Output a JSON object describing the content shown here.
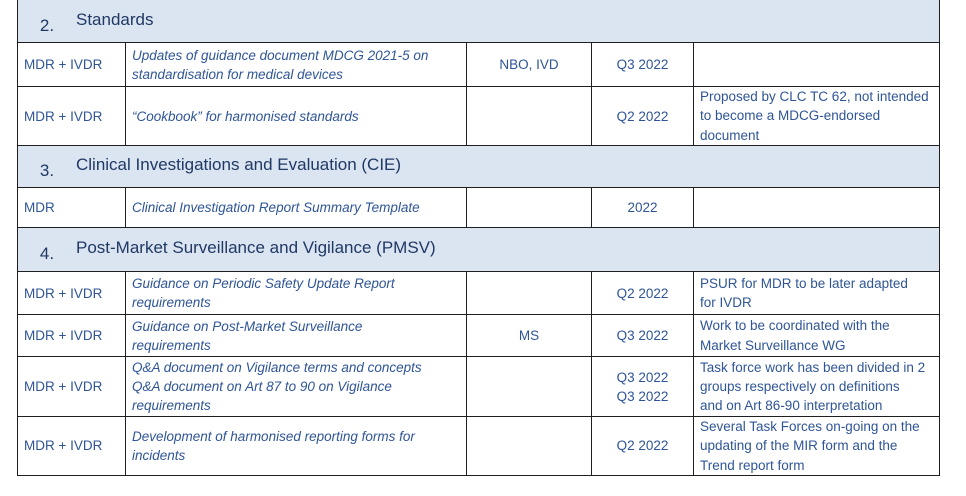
{
  "sections": [
    {
      "number": "2.",
      "title": "Standards"
    },
    {
      "number": "3.",
      "title": "Clinical Investigations and Evaluation (CIE)"
    },
    {
      "number": "4.",
      "title": "Post-Market Surveillance and Vigilance (PMSV)"
    }
  ],
  "rows": [
    {
      "scope": "MDR + IVDR",
      "document": [
        "Updates of guidance document MDCG 2021-5 on",
        "standardisation for medical devices"
      ],
      "stakeholders": "NBO, IVD",
      "timeline": [
        "Q3 2022"
      ],
      "comments": []
    },
    {
      "scope": "MDR + IVDR",
      "document": [
        "“Cookbook” for harmonised standards"
      ],
      "stakeholders": "",
      "timeline": [
        "Q2 2022"
      ],
      "comments": [
        "Proposed by CLC TC 62, not intended",
        "to become a MDCG-endorsed",
        "document"
      ]
    },
    {
      "scope": "MDR",
      "document": [
        "Clinical Investigation Report Summary Template"
      ],
      "stakeholders": "",
      "timeline": [
        "2022"
      ],
      "comments": []
    },
    {
      "scope": "MDR + IVDR",
      "document": [
        "Guidance on Periodic Safety Update Report",
        "requirements"
      ],
      "stakeholders": "",
      "timeline": [
        "Q2 2022"
      ],
      "comments": [
        "PSUR for MDR to be later adapted",
        "for IVDR"
      ]
    },
    {
      "scope": "MDR + IVDR",
      "document": [
        "Guidance on Post-Market Surveillance",
        "requirements"
      ],
      "stakeholders": "MS",
      "timeline": [
        "Q3 2022"
      ],
      "comments": [
        "Work to be coordinated with the",
        "Market Surveillance WG"
      ]
    },
    {
      "scope": "MDR + IVDR",
      "document": [
        "Q&A document on Vigilance terms and concepts",
        "Q&A document on Art 87 to 90 on Vigilance",
        "requirements"
      ],
      "stakeholders": "",
      "timeline": [
        "Q3 2022",
        "Q3 2022"
      ],
      "comments": [
        "Task force work has been divided in 2",
        "groups respectively on definitions",
        "and on Art 86-90 interpretation"
      ]
    },
    {
      "scope": "MDR + IVDR",
      "document": [
        "Development of harmonised reporting forms for",
        "incidents"
      ],
      "stakeholders": "",
      "timeline": [
        "Q2 2022"
      ],
      "comments": [
        "Several Task Forces on-going on the",
        "updating of the MIR form and the",
        "Trend report form"
      ]
    }
  ]
}
